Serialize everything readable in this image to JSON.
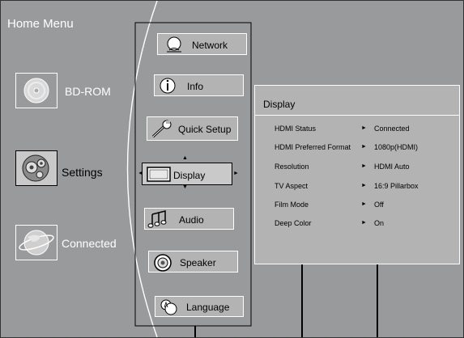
{
  "home": {
    "title": "Home Menu"
  },
  "sources": [
    {
      "label": "BD-ROM",
      "icon": "disc-icon"
    },
    {
      "label": "Settings",
      "icon": "gears-icon",
      "selected": true
    },
    {
      "label": "Connected",
      "icon": "globe-icon"
    }
  ],
  "menu": [
    {
      "label": "Network",
      "icon": "network-icon"
    },
    {
      "label": "Info",
      "icon": "info-icon"
    },
    {
      "label": "Quick Setup",
      "icon": "wrench-icon"
    },
    {
      "label": "Display",
      "icon": "monitor-icon",
      "selected": true
    },
    {
      "label": "Audio",
      "icon": "music-notes-icon"
    },
    {
      "label": "Speaker",
      "icon": "speaker-icon"
    },
    {
      "label": "Language",
      "icon": "language-icon"
    }
  ],
  "panel": {
    "title": "Display",
    "rows": [
      {
        "key": "HDMI Status",
        "value": "Connected"
      },
      {
        "key": "HDMI Preferred Format",
        "value": "1080p(HDMI)"
      },
      {
        "key": "Resolution",
        "value": "HDMI Auto"
      },
      {
        "key": "TV Aspect",
        "value": "16:9 Pillarbox"
      },
      {
        "key": "Film Mode",
        "value": "Off"
      },
      {
        "key": "Deep Color",
        "value": "On"
      }
    ]
  },
  "symbols": {
    "arrow": "►"
  }
}
